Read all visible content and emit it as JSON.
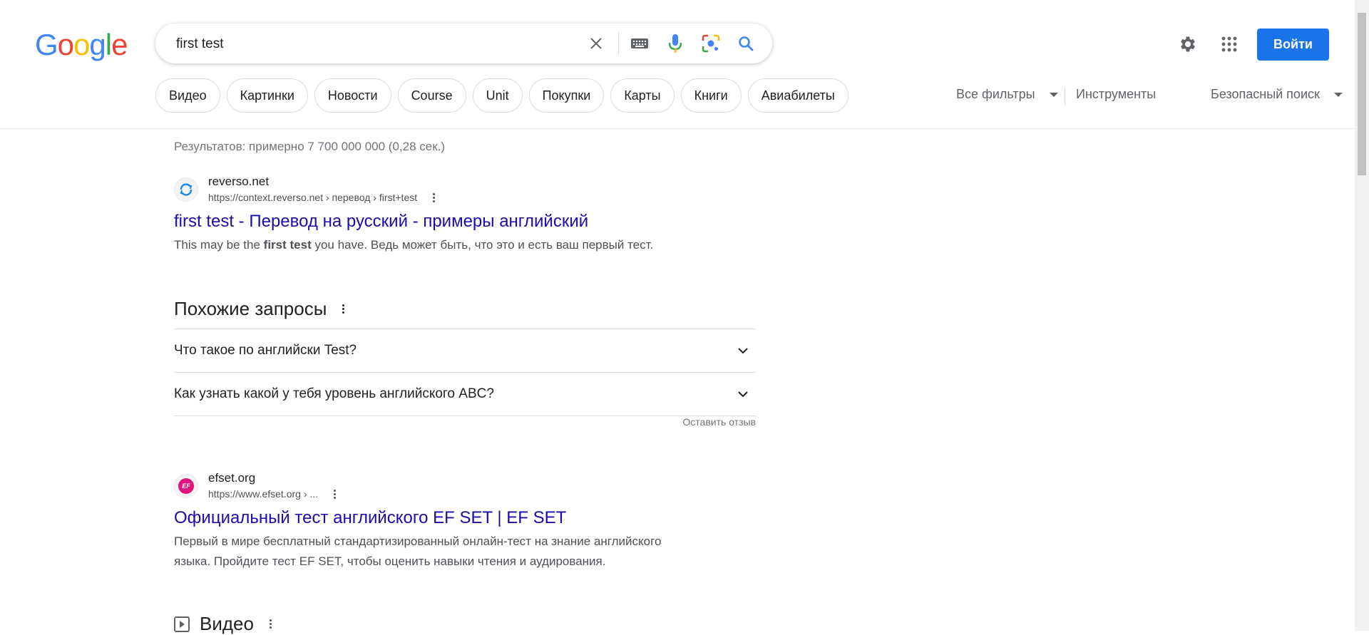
{
  "logo": {
    "letters": [
      "G",
      "o",
      "o",
      "g",
      "l",
      "e"
    ]
  },
  "search": {
    "value": "first test",
    "placeholder": ""
  },
  "search_icons": [
    "clear-icon",
    "keyboard-icon",
    "microphone-icon",
    "lens-icon",
    "search-icon"
  ],
  "header": {
    "signin_label": "Войти"
  },
  "chips": [
    "Видео",
    "Картинки",
    "Новости",
    "Course",
    "Unit",
    "Покупки",
    "Карты",
    "Книги",
    "Авиабилеты"
  ],
  "tools": {
    "all_filters": "Все фильтры",
    "instruments": "Инструменты",
    "safe_search": "Безопасный поиск"
  },
  "stats": "Результатов: примерно 7 700 000 000 (0,28 сек.)",
  "results": [
    {
      "site_name": "reverso.net",
      "url": "https://context.reverso.net › перевод › first+test",
      "title": "first test - Перевод на русский - примеры английский",
      "snippet_before": "This may be the ",
      "snippet_bold": "first test",
      "snippet_after": " you have. Ведь может быть, что это и есть ваш первый тест.",
      "favicon_color": "#1e88e5"
    },
    {
      "site_name": "efset.org",
      "url": "https://www.efset.org › ...",
      "title": "Официальный тест английского EF SET | EF SET",
      "snippet_line1": "Первый в мире бесплатный стандартизированный онлайн-тест на знание английского",
      "snippet_line2": "языка. Пройдите тест EF SET, чтобы оценить навыки чтения и аудирования.",
      "favicon_text": "EF",
      "favicon_color": "#e0157a"
    }
  ],
  "related": {
    "heading": "Похожие запросы",
    "items": [
      "Что такое по английски Test?",
      "Как узнать какой у тебя уровень английского ABC?"
    ],
    "feedback": "Оставить отзыв"
  },
  "video_heading": "Видео",
  "colors": {
    "link": "#1a0dab",
    "accent": "#1a73e8"
  }
}
